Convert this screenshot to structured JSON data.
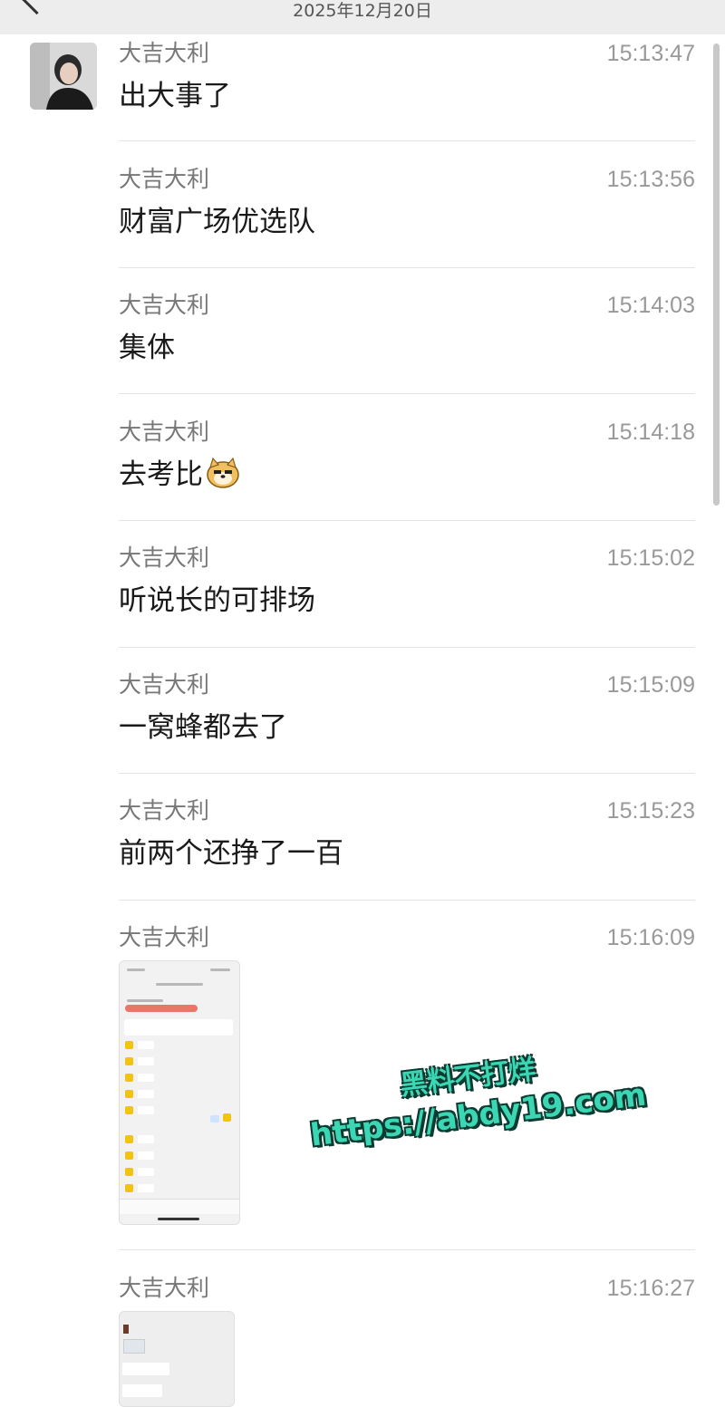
{
  "header": {
    "date": "2025年12月20日"
  },
  "messages": [
    {
      "sender": "大吉大利",
      "time": "15:13:47",
      "text": "出大事了"
    },
    {
      "sender": "大吉大利",
      "time": "15:13:56",
      "text": "财富广场优选队"
    },
    {
      "sender": "大吉大利",
      "time": "15:14:03",
      "text": "集体"
    },
    {
      "sender": "大吉大利",
      "time": "15:14:18",
      "text": "去考比"
    },
    {
      "sender": "大吉大利",
      "time": "15:15:02",
      "text": "听说长的可排场"
    },
    {
      "sender": "大吉大利",
      "time": "15:15:09",
      "text": "一窝蜂都去了"
    },
    {
      "sender": "大吉大利",
      "time": "15:15:23",
      "text": "前两个还挣了一百"
    },
    {
      "sender": "大吉大利",
      "time": "15:16:09"
    },
    {
      "sender": "大吉大利",
      "time": "15:16:27"
    }
  ],
  "watermark": {
    "line1": "黑料不打烊",
    "line2": "https://abdy19.com"
  },
  "icons": {
    "back": "chevron-left-icon",
    "emoji": "doge-emoji-icon"
  }
}
